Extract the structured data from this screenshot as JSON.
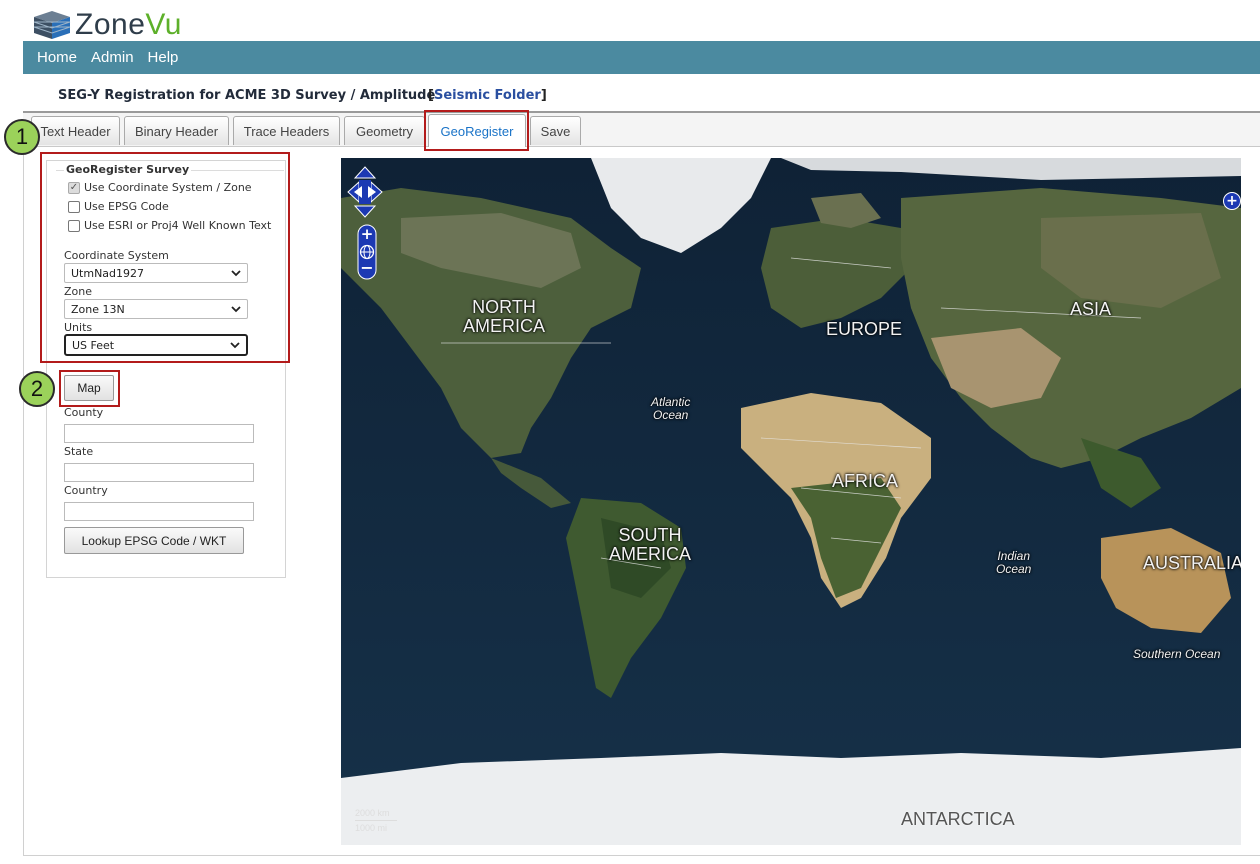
{
  "app": {
    "logo_zone": "Zone",
    "logo_vu": "Vu"
  },
  "nav": {
    "items": [
      "Home",
      "Admin",
      "Help"
    ]
  },
  "page": {
    "title": "SEG-Y Registration for ACME 3D Survey / Amplitude",
    "link_open": "[",
    "link_text": "Seismic Folder",
    "link_close": "]"
  },
  "tabs": [
    {
      "label": "Text Header"
    },
    {
      "label": "Binary Header"
    },
    {
      "label": "Trace Headers"
    },
    {
      "label": "Geometry"
    },
    {
      "label": "GeoRegister",
      "active": true
    },
    {
      "label": "Save"
    }
  ],
  "georegister": {
    "legend": "GeoRegister Survey",
    "options": [
      {
        "label": "Use Coordinate System / Zone",
        "checked": true
      },
      {
        "label": "Use EPSG Code",
        "checked": false
      },
      {
        "label": "Use ESRI or Proj4 Well Known Text",
        "checked": false
      }
    ],
    "coordinate_system_label": "Coordinate System",
    "coordinate_system_value": "UtmNad1927",
    "zone_label": "Zone",
    "zone_value": "Zone 13N",
    "units_label": "Units",
    "units_value": "US Feet"
  },
  "lookup": {
    "map_button": "Map",
    "county_label": "County",
    "county_value": "",
    "state_label": "State",
    "state_value": "",
    "country_label": "Country",
    "country_value": "",
    "lookup_button": "Lookup EPSG Code / WKT"
  },
  "callouts": [
    "1",
    "2"
  ],
  "map": {
    "continents": [
      "NORTH",
      "AMERICA",
      "EUROPE",
      "ASIA",
      "AFRICA",
      "SOUTH",
      "AMERICA",
      "AUSTRALIA",
      "ANTARCTICA"
    ],
    "oceans": [
      "Atlantic",
      "Ocean",
      "Indian",
      "Ocean",
      "Southern Ocean"
    ],
    "scale_km": "2000 km",
    "scale_mi": "1000 mi",
    "zoom_in": "+",
    "zoom_out": "−",
    "expand": "+"
  },
  "colors": {
    "navbar": "#4b8aa0",
    "highlight": "#b31b1b",
    "callout": "#9bd25a",
    "active_tab_text": "#1a73c7",
    "map_control": "#1c39b3"
  }
}
